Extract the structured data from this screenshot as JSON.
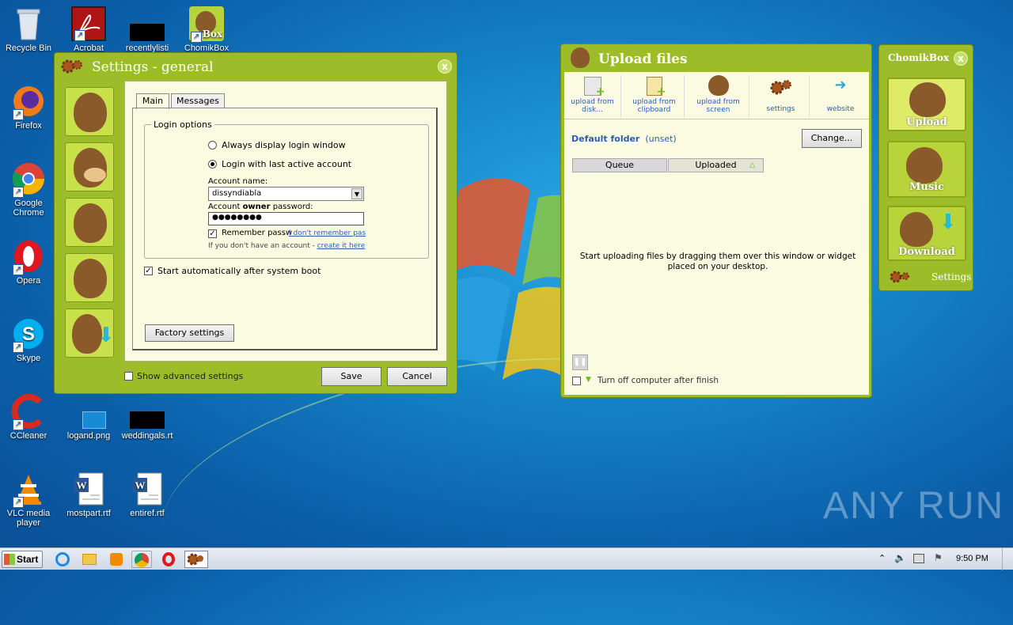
{
  "desktop": {
    "icons": [
      {
        "label": "Recycle Bin",
        "icon": "recycle-bin-icon"
      },
      {
        "label": "Acrobat",
        "icon": "acrobat-icon"
      },
      {
        "label": "recentlylisti",
        "icon": "blacked-file-icon"
      },
      {
        "label": "ChomikBox",
        "icon": "chomikbox-icon"
      },
      {
        "label": "Firefox",
        "icon": "firefox-icon"
      },
      {
        "label": "Google Chrome",
        "icon": "chrome-icon"
      },
      {
        "label": "Opera",
        "icon": "opera-icon"
      },
      {
        "label": "Skype",
        "icon": "skype-icon"
      },
      {
        "label": "CCleaner",
        "icon": "ccleaner-icon"
      },
      {
        "label": "logand.png",
        "icon": "image-file-icon"
      },
      {
        "label": "weddingals.rt",
        "icon": "blacked-file-icon"
      },
      {
        "label": "VLC media player",
        "icon": "vlc-icon"
      },
      {
        "label": "mostpart.rtf",
        "icon": "word-doc-icon"
      },
      {
        "label": "entiref.rtf",
        "icon": "word-doc-icon"
      }
    ],
    "watermark": "ANY RUN"
  },
  "settings": {
    "title": "Settings - general",
    "tabs": [
      "Main",
      "Messages"
    ],
    "group_title": "Login options",
    "radio_always": "Always display login window",
    "radio_last": "Login with last active account",
    "account_name_label": "Account name:",
    "account_name_value": "dissyndiabla",
    "password_label_pre": "Account ",
    "password_label_bold": "owner",
    "password_label_post": " password:",
    "password_value": "●●●●●●●●",
    "remember_label": "Remember passw",
    "forgot_link": "I don't remember pas",
    "no_account_text": "If you don't have an account - ",
    "create_link": "create it here",
    "autostart_label": "Start automatically after system boot",
    "factory_btn": "Factory settings",
    "advanced_label": "Show advanced settings",
    "save_btn": "Save",
    "cancel_btn": "Cancel"
  },
  "upload": {
    "title": "Upload files",
    "toolbar": [
      {
        "line1": "upload from",
        "line2": "disk...",
        "icon": "upload-disk-icon"
      },
      {
        "line1": "upload from",
        "line2": "clipboard",
        "icon": "upload-clipboard-icon"
      },
      {
        "line1": "upload from",
        "line2": "screen",
        "icon": "upload-screen-icon"
      },
      {
        "line1": "settings",
        "line2": "",
        "icon": "gears-icon"
      },
      {
        "line1": "website",
        "line2": "",
        "icon": "website-icon"
      }
    ],
    "default_folder_label": "Default folder",
    "default_folder_value": "(unset)",
    "change_btn": "Change...",
    "tab_queue": "Queue",
    "tab_uploaded": "Uploaded",
    "hint": "Start uploading files by dragging them over this window or widget placed on your desktop.",
    "shutdown_label": "Turn off computer after finish"
  },
  "chomikbox": {
    "title": "ChomikBox",
    "upload": "Upload",
    "music": "Music",
    "download": "Download",
    "settings": "Settings"
  },
  "taskbar": {
    "start": "Start",
    "time": "9:50 PM"
  },
  "colors": {
    "window_green": "#9cbc2a",
    "cream": "#fbfbe2",
    "link_blue": "#2a5db0"
  }
}
